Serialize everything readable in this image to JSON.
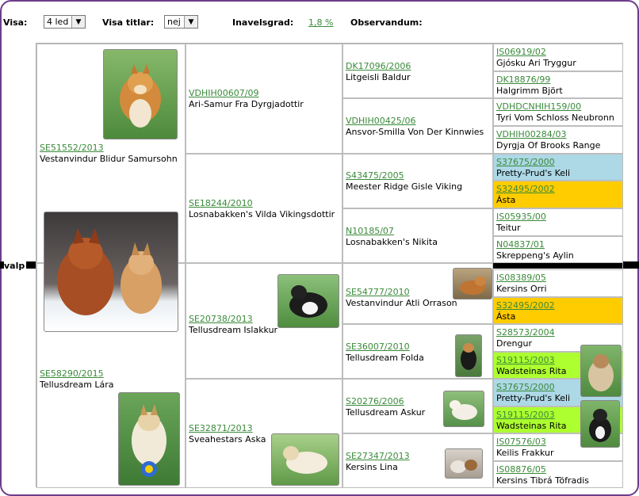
{
  "controls": {
    "visa_label": "Visa:",
    "visa_value": "4 led",
    "titlar_label": "Visa titlar:",
    "titlar_value": "nej",
    "inavel_label": "Inavelsgrad:",
    "inavel_value": "1,8 %",
    "observandum_label": "Observandum:"
  },
  "subject_label": "valp",
  "colors": {
    "frame": "#6d3c8a",
    "link": "#3a8a3a",
    "blue": "#add8e6",
    "orange": "#ffcc00",
    "green": "#adff2f"
  },
  "gen1": [
    {
      "reg": "SE51552/2013",
      "name": "Vestanvindur Blidur Samursohn"
    },
    {
      "reg": "SE58290/2015",
      "name": "Tellusdream Lára"
    }
  ],
  "gen2": [
    {
      "reg": "VDHIH00607/09",
      "name": "Ari-Samur Fra Dyrgjadottir"
    },
    {
      "reg": "SE18244/2010",
      "name": "Losnabakken's Vilda Vikingsdottir"
    },
    {
      "reg": "SE20738/2013",
      "name": "Tellusdream Islakkur"
    },
    {
      "reg": "SE32871/2013",
      "name": "Sveahestars Aska"
    }
  ],
  "gen3": [
    {
      "reg": "DK17096/2006",
      "name": "Litgeisli Baldur"
    },
    {
      "reg": "VDHIH00425/06",
      "name": "Ansvor-Smilla Von Der Kinnwies"
    },
    {
      "reg": "S43475/2005",
      "name": "Meester Ridge Gisle Viking"
    },
    {
      "reg": "N10185/07",
      "name": "Losnabakken's Nikita"
    },
    {
      "reg": "SE54777/2010",
      "name": "Vestanvindur Atli Orrason"
    },
    {
      "reg": "SE36007/2010",
      "name": "Tellusdream Folda"
    },
    {
      "reg": "S20276/2006",
      "name": "Tellusdream Askur"
    },
    {
      "reg": "SE27347/2013",
      "name": "Kersins Lina"
    }
  ],
  "gen4": [
    {
      "reg": "IS06919/02",
      "name": "Gjósku Ari Tryggur"
    },
    {
      "reg": "DK18876/99",
      "name": "Halgrimm Björt"
    },
    {
      "reg": "VDHDCNHIH159/00",
      "name": "Tyri Vom Schloss Neubronn"
    },
    {
      "reg": "VDHIH00284/03",
      "name": "Dyrgja Of Brooks Range"
    },
    {
      "reg": "S37675/2000",
      "name": "Pretty-Prud's Keli"
    },
    {
      "reg": "S32495/2002",
      "name": "Ásta"
    },
    {
      "reg": "IS05935/00",
      "name": "Teitur"
    },
    {
      "reg": "N04837/01",
      "name": "Skreppeng's Aylin"
    },
    {
      "reg": "IS08389/05",
      "name": "Kersins Orri"
    },
    {
      "reg": "S32495/2002",
      "name": "Ásta"
    },
    {
      "reg": "S28573/2004",
      "name": "Drengur"
    },
    {
      "reg": "S19115/2003",
      "name": "Wadsteinas Rita"
    },
    {
      "reg": "S37675/2000",
      "name": "Pretty-Prud's Keli"
    },
    {
      "reg": "S19115/2003",
      "name": "Wadsteinas Rita"
    },
    {
      "reg": "IS07576/03",
      "name": "Keilis Frakkur"
    },
    {
      "reg": "IS08876/05",
      "name": "Kersins Tibrá Töfradis"
    }
  ]
}
